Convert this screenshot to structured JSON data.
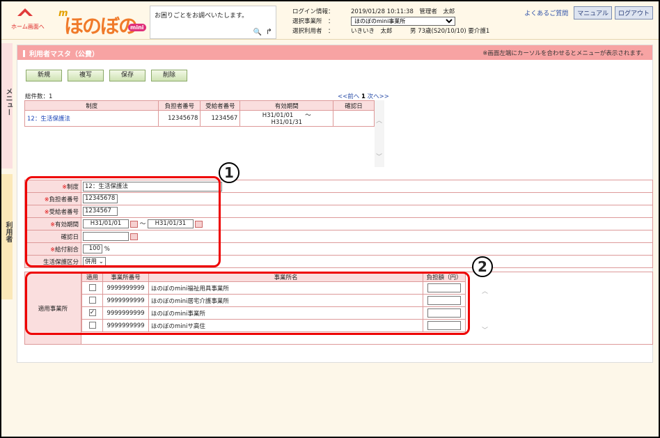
{
  "header": {
    "home_label": "ホーム画面へ",
    "logo_text": "ほのぼの",
    "logo_badge": "mini",
    "search_text": "お困りごとをお調べいたします。",
    "info": {
      "login_key": "ログイン情報：",
      "login_val": "2019/01/28 10:11:38　管理者　太郎",
      "office_key": "選択事業所　：",
      "office_val": "ほのぼのmini事業所",
      "user_key": "選択利用者　：",
      "user_val": "いきいき　太郎　　　男 73歳(S20/10/10) 要介護1"
    },
    "faq": "よくあるご質問",
    "manual": "マニュアル",
    "logout": "ログアウト"
  },
  "side": {
    "menu_tab": "メニュー",
    "user_tab": "利用者"
  },
  "page": {
    "title": "利用者マスタ（公費）",
    "hint": "※画面左端にカーソルを合わせるとメニューが表示されます。",
    "buttons": {
      "new": "新規",
      "copy": "複写",
      "save": "保存",
      "delete": "削除"
    },
    "total": "総件数：1",
    "pager": {
      "prev": "<<前へ",
      "page": "1",
      "next": "次へ>>"
    }
  },
  "list": {
    "headers": [
      "制度",
      "負担者番号",
      "受給者番号",
      "有効期間",
      "確認日"
    ],
    "rows": [
      {
        "seido": "12：生活保護法",
        "futan": "12345678",
        "jukyu": "1234567",
        "kikan": "H31/01/01　　～　　H31/01/31",
        "kakunin": ""
      }
    ]
  },
  "form": {
    "seido_label": "制度",
    "seido_val": "12：生活保護法",
    "futan_label": "負担者番号",
    "futan_val": "12345678",
    "jukyu_label": "受給者番号",
    "jukyu_val": "1234567",
    "kikan_label": "有効期間",
    "kikan_from": "H31/01/01",
    "kikan_sep": "～",
    "kikan_to": "H31/01/31",
    "kakunin_label": "確認日",
    "kakunin_val": "",
    "kyufu_label": "給付割合",
    "kyufu_val": "100",
    "kyufu_unit": "%",
    "kubun_label": "生活保護区分",
    "kubun_val": "併用",
    "req_mark": "※"
  },
  "offices": {
    "label": "適用事業所",
    "headers": [
      "適用",
      "事業所番号",
      "事業所名",
      "負担額（円）"
    ],
    "rows": [
      {
        "checked": false,
        "no": "9999999999",
        "name": "ほのぼのmini福祉用具事業所"
      },
      {
        "checked": false,
        "no": "9999999999",
        "name": "ほのぼのmini居宅介護事業所"
      },
      {
        "checked": true,
        "no": "9999999999",
        "name": "ほのぼのmini事業所"
      },
      {
        "checked": false,
        "no": "9999999999",
        "name": "ほのぼのminiサ高住"
      }
    ]
  },
  "callouts": {
    "one": "1",
    "two": "2"
  },
  "colors": {
    "title_bar": "#f7a3a3",
    "label_bg": "#fadede",
    "callout": "#e00000",
    "side_menu": "#fbe0e0",
    "side_user": "#fbe8b8"
  }
}
